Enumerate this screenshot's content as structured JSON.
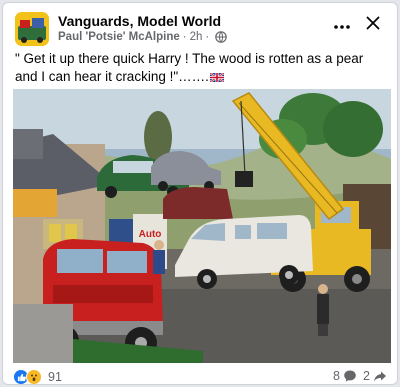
{
  "post": {
    "group_name": "Vanguards, Model World",
    "author": "Paul 'Potsie' McAlpine",
    "time": "2h",
    "separator": "·",
    "privacy_icon": "globe-icon",
    "more_icon": "more-dots-icon",
    "close_icon": "close-icon",
    "caption": "\" Get it up there quick Harry ! The wood is rotten as a pear and I can hear it cracking !\"…….",
    "caption_flag_icon": "union-jack-flag-icon",
    "photo_sign_text": "Auto"
  },
  "footer": {
    "reaction_icons": [
      "like-icon",
      "wow-icon"
    ],
    "reaction_count": "91",
    "comment_count": "8",
    "comment_icon": "comment-icon",
    "share_count": "2",
    "share_icon": "share-icon"
  },
  "colors": {
    "link_blue": "#1877f2",
    "wow_yellow": "#f7b928",
    "meta_grey": "#65676b",
    "text": "#050505",
    "crane_yellow": "#e8b923",
    "bus_red": "#c8201e"
  }
}
